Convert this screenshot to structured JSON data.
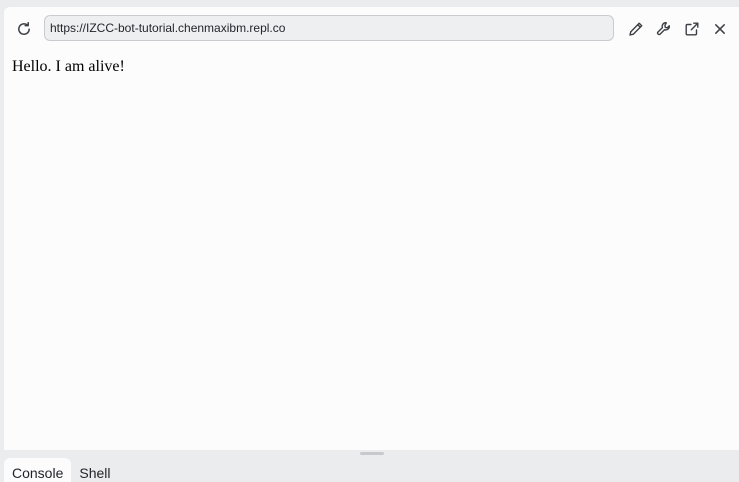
{
  "webview": {
    "url": "https://IZCC-bot-tutorial.chenmaxibm.repl.co",
    "content_text": "Hello. I am alive!"
  },
  "toolbar": {
    "reload_icon": "reload-icon",
    "edit_icon": "pencil-icon",
    "tools_icon": "wrench-icon",
    "open_external_icon": "external-link-icon",
    "close_icon": "close-icon"
  },
  "tabs": [
    {
      "label": "Console",
      "active": true
    },
    {
      "label": "Shell",
      "active": false
    }
  ],
  "colors": {
    "panel_background": "#fcfcfc",
    "chrome_background": "#ebecee",
    "url_bar_background": "#eeeff1",
    "icon_color": "#3c3f44"
  }
}
